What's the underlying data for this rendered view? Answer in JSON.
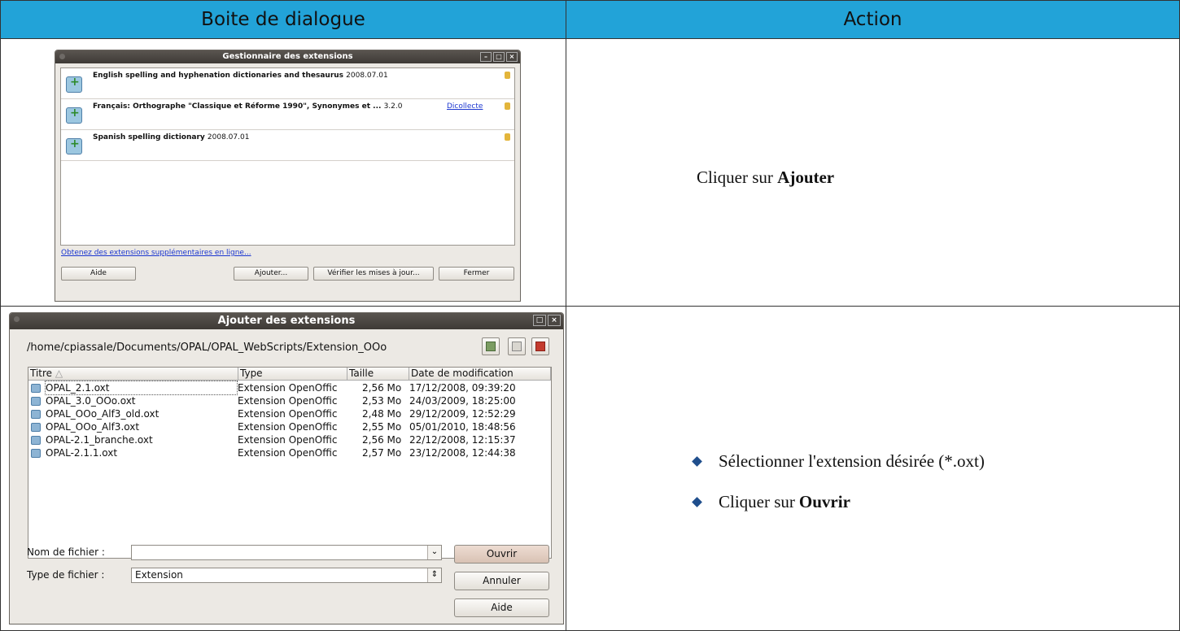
{
  "table": {
    "header_left": "Boite de dialogue",
    "header_right": "Action"
  },
  "row1": {
    "action_prefix": "Cliquer sur ",
    "action_bold": "Ajouter"
  },
  "row2": {
    "bullet1": "Sélectionner l'extension désirée (*.oxt)",
    "bullet2_prefix": "Cliquer sur ",
    "bullet2_bold": "Ouvrir"
  },
  "win1": {
    "title": "Gestionnaire des extensions",
    "extensions": [
      {
        "name": "English spelling and hyphenation dictionaries and thesaurus",
        "version": "2008.07.01",
        "link": ""
      },
      {
        "name": "Français: Orthographe \"Classique et Réforme 1990\", Synonymes et ...",
        "version": "3.2.0",
        "link": "Dicollecte"
      },
      {
        "name": "Spanish spelling dictionary",
        "version": "2008.07.01",
        "link": ""
      }
    ],
    "more_link": "Obtenez des extensions supplémentaires en ligne...",
    "buttons": {
      "help": "Aide",
      "add": "Ajouter...",
      "check_updates": "Vérifier les mises à jour...",
      "close": "Fermer"
    }
  },
  "win2": {
    "title": "Ajouter des extensions",
    "path": "/home/cpiassale/Documents/OPAL/OPAL_WebScripts/Extension_OOo",
    "columns": [
      "Titre",
      "Type",
      "Taille",
      "Date de modification"
    ],
    "files": [
      {
        "name": "OPAL_2.1.oxt",
        "type": "Extension OpenOffic",
        "size": "2,56 Mo",
        "date": "17/12/2008, 09:39:20"
      },
      {
        "name": "OPAL_3.0_OOo.oxt",
        "type": "Extension OpenOffic",
        "size": "2,53 Mo",
        "date": "24/03/2009, 18:25:00"
      },
      {
        "name": "OPAL_OOo_Alf3_old.oxt",
        "type": "Extension OpenOffic",
        "size": "2,48 Mo",
        "date": "29/12/2009, 12:52:29"
      },
      {
        "name": "OPAL_OOo_Alf3.oxt",
        "type": "Extension OpenOffic",
        "size": "2,55 Mo",
        "date": "05/01/2010, 18:48:56"
      },
      {
        "name": "OPAL-2.1_branche.oxt",
        "type": "Extension OpenOffic",
        "size": "2,56 Mo",
        "date": "22/12/2008, 12:15:37"
      },
      {
        "name": "OPAL-2.1.1.oxt",
        "type": "Extension OpenOffic",
        "size": "2,57 Mo",
        "date": "23/12/2008, 12:44:38"
      }
    ],
    "filename_label": "Nom de fichier :",
    "filename_value": "",
    "filetype_label": "Type de fichier :",
    "filetype_value": "Extension",
    "buttons": {
      "open": "Ouvrir",
      "cancel": "Annuler",
      "help": "Aide"
    }
  }
}
